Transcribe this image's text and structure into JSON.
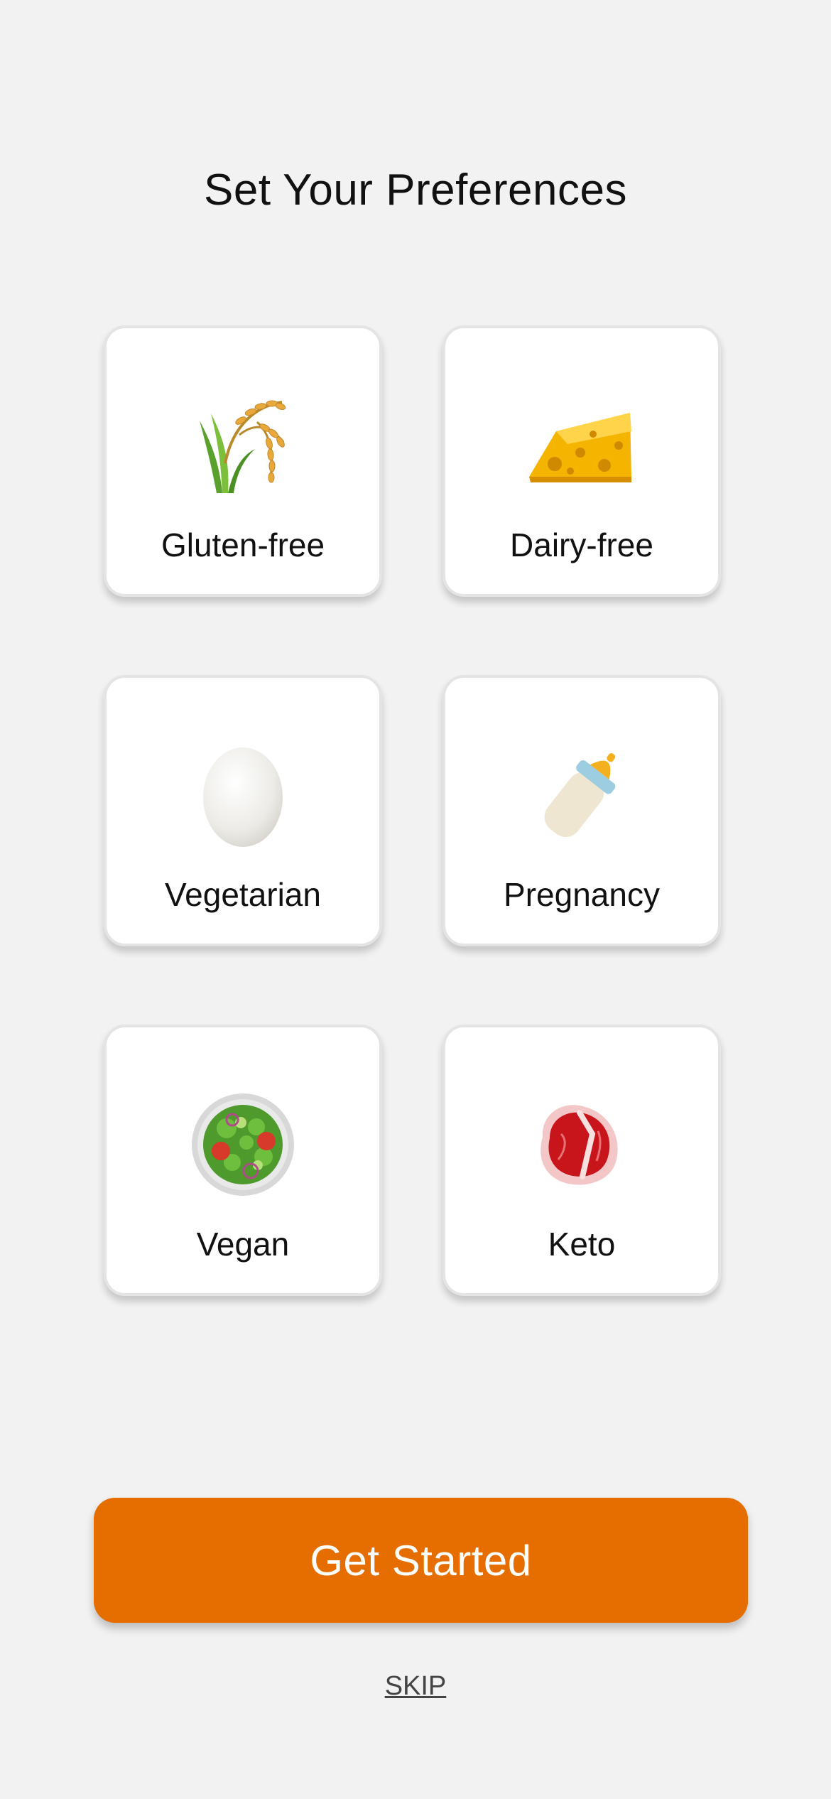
{
  "header": {
    "title": "Set Your Preferences"
  },
  "preferences": [
    {
      "label": "Gluten-free",
      "icon": "rice-plant-icon"
    },
    {
      "label": "Dairy-free",
      "icon": "cheese-icon"
    },
    {
      "label": "Vegetarian",
      "icon": "egg-icon"
    },
    {
      "label": "Pregnancy",
      "icon": "baby-bottle-icon"
    },
    {
      "label": "Vegan",
      "icon": "salad-icon"
    },
    {
      "label": "Keto",
      "icon": "steak-icon"
    }
  ],
  "actions": {
    "primary_label": "Get Started",
    "skip_label": "SKIP"
  },
  "colors": {
    "background": "#f2f2f2",
    "card": "#ffffff",
    "accent": "#e66d00",
    "text": "#111111"
  }
}
